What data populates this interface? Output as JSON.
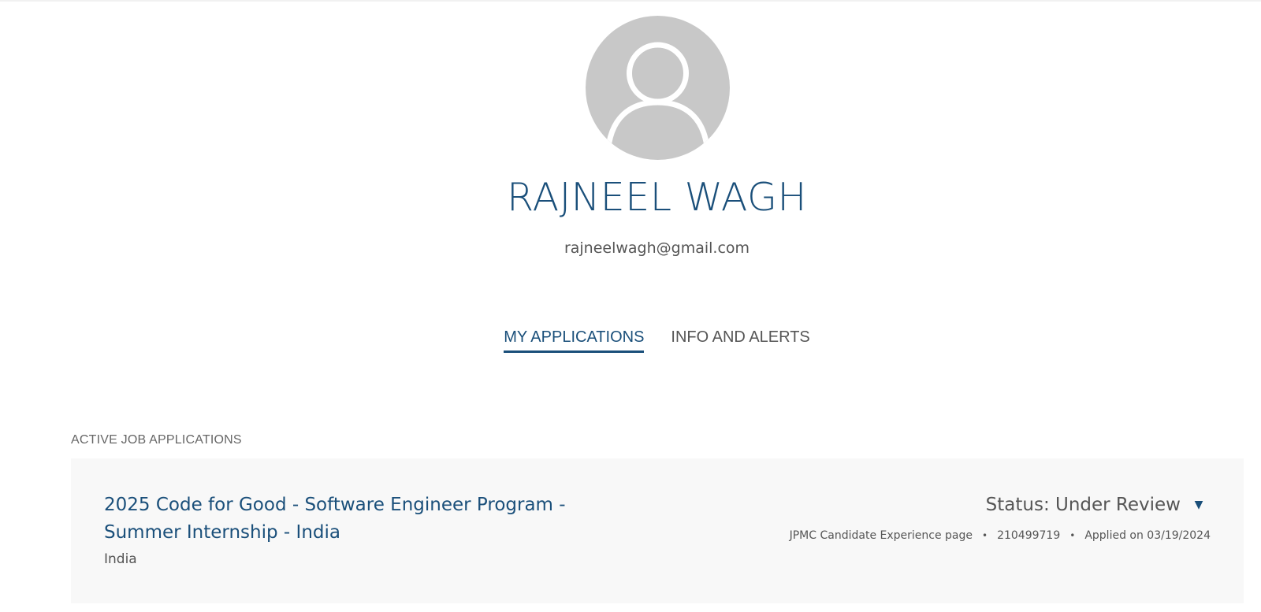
{
  "profile": {
    "name": "RAJNEEL WAGH",
    "email": "rajneelwagh@gmail.com",
    "avatar_icon": "user-silhouette-icon"
  },
  "tabs": [
    {
      "label": "MY APPLICATIONS",
      "active": true
    },
    {
      "label": "INFO AND ALERTS",
      "active": false
    }
  ],
  "section": {
    "title": "ACTIVE JOB APPLICATIONS"
  },
  "application": {
    "title": "2025 Code for Good - Software Engineer Program - Summer Internship - India",
    "location": "India",
    "status": "Status: Under Review",
    "status_icon": "caret-down-icon",
    "source": "JPMC Candidate Experience page",
    "requisition_id": "210499719",
    "applied": "Applied on 03/19/2024"
  },
  "colors": {
    "accent": "#1a4f7a",
    "text_muted": "#555555",
    "card_bg": "#f8f8f8",
    "avatar_bg": "#c8c8c8"
  }
}
